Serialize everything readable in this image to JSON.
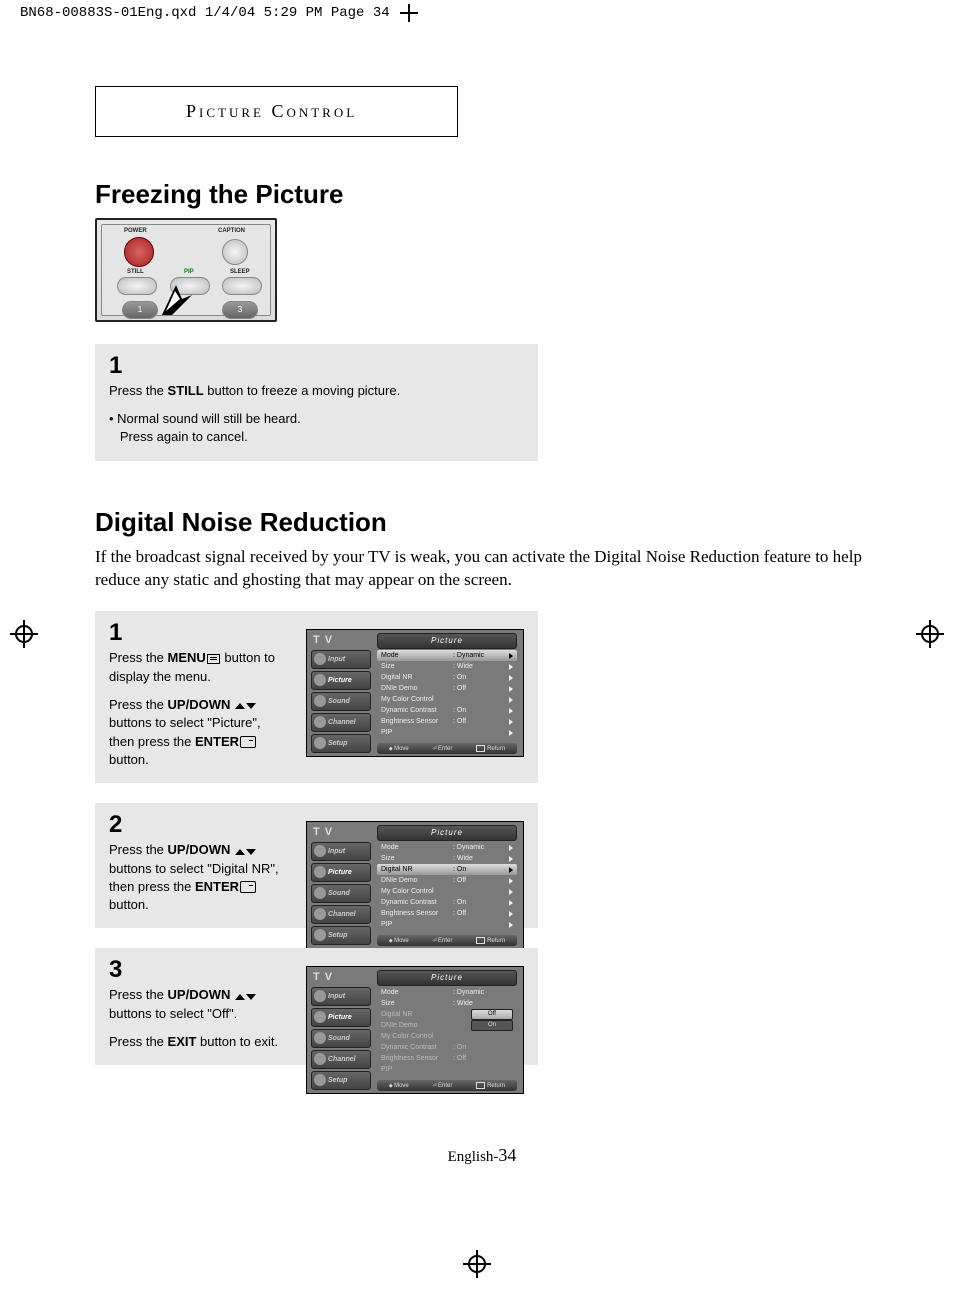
{
  "header_line": "BN68-00883S-01Eng.qxd  1/4/04 5:29 PM  Page 34",
  "section_box": "Picture Control",
  "h1_freezing": "Freezing the Picture",
  "remote_labels": {
    "power": "POWER",
    "caption": "CAPTION",
    "still": "STILL",
    "pip": "PIP",
    "sleep": "SLEEP",
    "n1": "1",
    "n3": "3"
  },
  "step_freeze": {
    "num": "1",
    "line1_a": "Press the ",
    "line1_b": "STILL",
    "line1_c": " button to freeze a moving picture.",
    "bullet1": "• Normal sound will still be heard.",
    "bullet2": "   Press again to cancel."
  },
  "h1_dnr": "Digital Noise Reduction",
  "dnr_intro": "If the broadcast signal received by your TV is weak, you can activate the Digital Noise Reduction feature to help reduce any static and ghosting that may appear on the screen.",
  "osd_common": {
    "tv": "T V",
    "title": "Picture",
    "sidebar": [
      "Input",
      "Picture",
      "Sound",
      "Channel",
      "Setup"
    ],
    "rows": [
      {
        "lbl": "Mode",
        "val": ": Dynamic"
      },
      {
        "lbl": "Size",
        "val": ": Wide"
      },
      {
        "lbl": "Digital NR",
        "val": ": On"
      },
      {
        "lbl": "DNIe Demo",
        "val": ": Off"
      },
      {
        "lbl": "My Color Control",
        "val": ""
      },
      {
        "lbl": "Dynamic Contrast",
        "val": ": On"
      },
      {
        "lbl": "Brightness Sensor",
        "val": ": Off"
      },
      {
        "lbl": "PIP",
        "val": ""
      }
    ],
    "bottom": {
      "move": "Move",
      "enter": "Enter",
      "ret": "Return"
    }
  },
  "step1": {
    "num": "1",
    "p1a": "Press the ",
    "p1b": "MENU",
    "p1c": " button to display the menu.",
    "p2a": "Press the ",
    "p2b": "UP/DOWN",
    "p2c": " buttons to select \"Picture\", then press the ",
    "p2d": "ENTER",
    "p2e": " button."
  },
  "step2": {
    "num": "2",
    "p1a": "Press the ",
    "p1b": "UP/DOWN",
    "p1c": " buttons to select \"Digital NR\", then press the ",
    "p1d": "ENTER",
    "p1e": " button."
  },
  "step3": {
    "num": "3",
    "p1a": "Press the ",
    "p1b": "UP/DOWN",
    "p1c": " buttons to select \"Off\".",
    "p2a": "Press the ",
    "p2b": "EXIT",
    "p2c": " button to exit.",
    "pill_off": "Off",
    "pill_on": "On"
  },
  "footer_a": "English-",
  "footer_b": "34"
}
